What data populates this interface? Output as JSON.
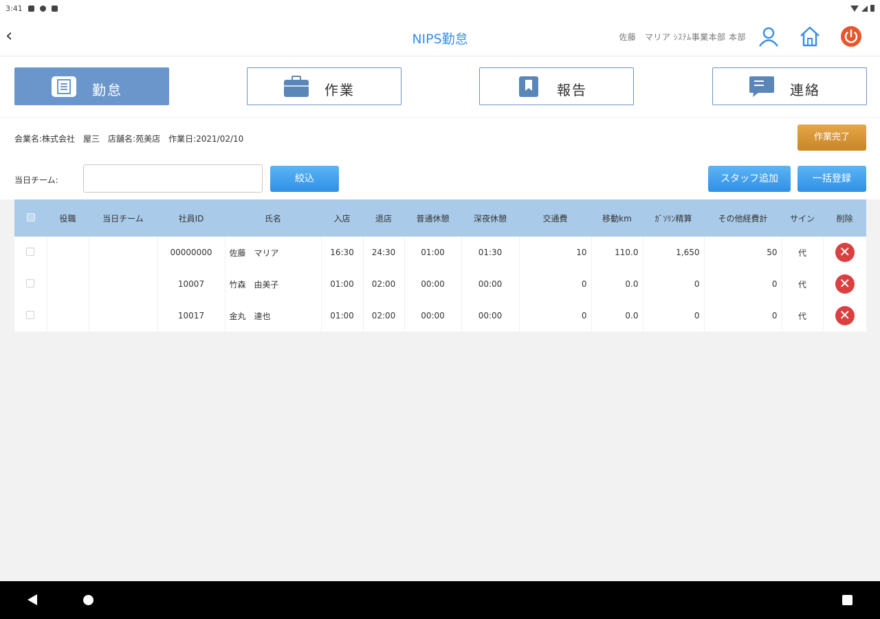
{
  "status_bar": {
    "time": "3:41"
  },
  "header": {
    "back_icon": "back-chevron-icon",
    "title": "NIPS勤怠",
    "user_info": "佐藤　マリア ｼｽﾃﾑ事業本部 本部",
    "icons": [
      "user-icon",
      "home-icon",
      "power-icon"
    ],
    "accent_color": "#3a8ee6",
    "power_color": "#e8542c"
  },
  "tabs": [
    {
      "label": "勤怠",
      "icon": "document-icon",
      "active": true
    },
    {
      "label": "作業",
      "icon": "briefcase-icon",
      "active": false
    },
    {
      "label": "報告",
      "icon": "bookmark-icon",
      "active": false
    },
    {
      "label": "連絡",
      "icon": "chat-icon",
      "active": false
    }
  ],
  "info": {
    "text": "会業名:株式会社　屋三　店舗名:苑美店　作業日:2021/02/10",
    "complete_label": "作業完了"
  },
  "filter": {
    "label": "当日チーム:",
    "value": "",
    "filter_button": "絞込",
    "add_staff_button": "スタッフ追加",
    "bulk_register_button": "一括登録"
  },
  "table": {
    "columns": [
      "",
      "役職",
      "当日チーム",
      "社員ID",
      "氏名",
      "入店",
      "退店",
      "普通休憩",
      "深夜休憩",
      "交通費",
      "移動km",
      "ｶﾞｿﾘﾝ精算",
      "その他経費計",
      "サイン",
      "削除"
    ],
    "rows": [
      {
        "role": "",
        "team": "",
        "id": "00000000",
        "name": "佐藤　マリア",
        "in": "16:30",
        "out": "24:30",
        "break": "01:00",
        "night_break": "01:30",
        "transport": "10",
        "km": "110.0",
        "gas": "1,650",
        "other": "50",
        "sign": "代"
      },
      {
        "role": "",
        "team": "",
        "id": "10007",
        "name": "竹森　由美子",
        "in": "01:00",
        "out": "02:00",
        "break": "00:00",
        "night_break": "00:00",
        "transport": "0",
        "km": "0.0",
        "gas": "0",
        "other": "0",
        "sign": "代"
      },
      {
        "role": "",
        "team": "",
        "id": "10017",
        "name": "金丸　達也",
        "in": "01:00",
        "out": "02:00",
        "break": "00:00",
        "night_break": "00:00",
        "transport": "0",
        "km": "0.0",
        "gas": "0",
        "other": "0",
        "sign": "代"
      }
    ]
  },
  "delete_icon": "close-circle-icon",
  "nav_bar": {
    "icons": [
      "back-triangle-icon",
      "home-circle-icon",
      "recent-square-icon"
    ]
  }
}
